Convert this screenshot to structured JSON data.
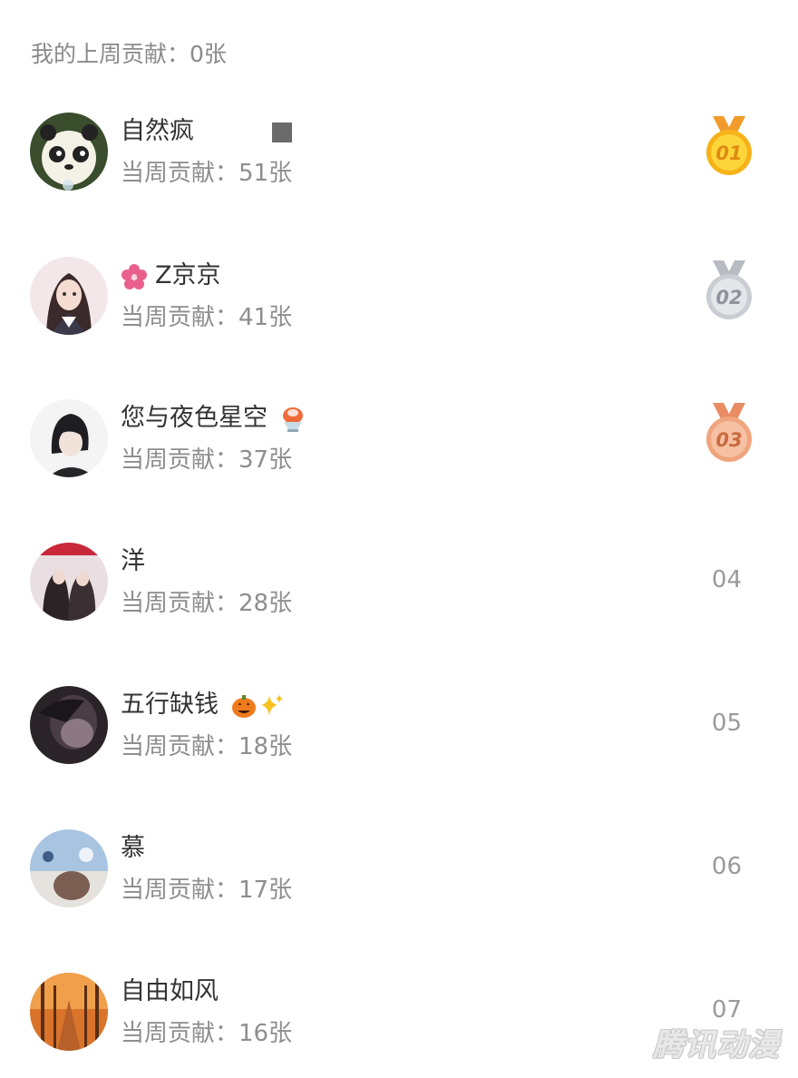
{
  "summary": {
    "label": "我的上周贡献：0张"
  },
  "users": [
    {
      "name": "自然疯",
      "contribution": "当周贡献：51张",
      "rank": "01"
    },
    {
      "name": "Z京京",
      "contribution": "当周贡献：41张",
      "rank": "02"
    },
    {
      "name": "您与夜色星空",
      "contribution": "当周贡献：37张",
      "rank": "03"
    },
    {
      "name": "洋",
      "contribution": "当周贡献：28张",
      "rank": "04"
    },
    {
      "name": "五行缺钱",
      "contribution": "当周贡献：18张",
      "rank": "05"
    },
    {
      "name": "慕",
      "contribution": "当周贡献：17张",
      "rank": "06"
    },
    {
      "name": "自由如风",
      "contribution": "当周贡献：16张",
      "rank": "07"
    }
  ],
  "watermark": "腾讯动漫",
  "colors": {
    "gold": "#f7b81e",
    "silver": "#c9cdd3",
    "bronze": "#f0a57f"
  }
}
